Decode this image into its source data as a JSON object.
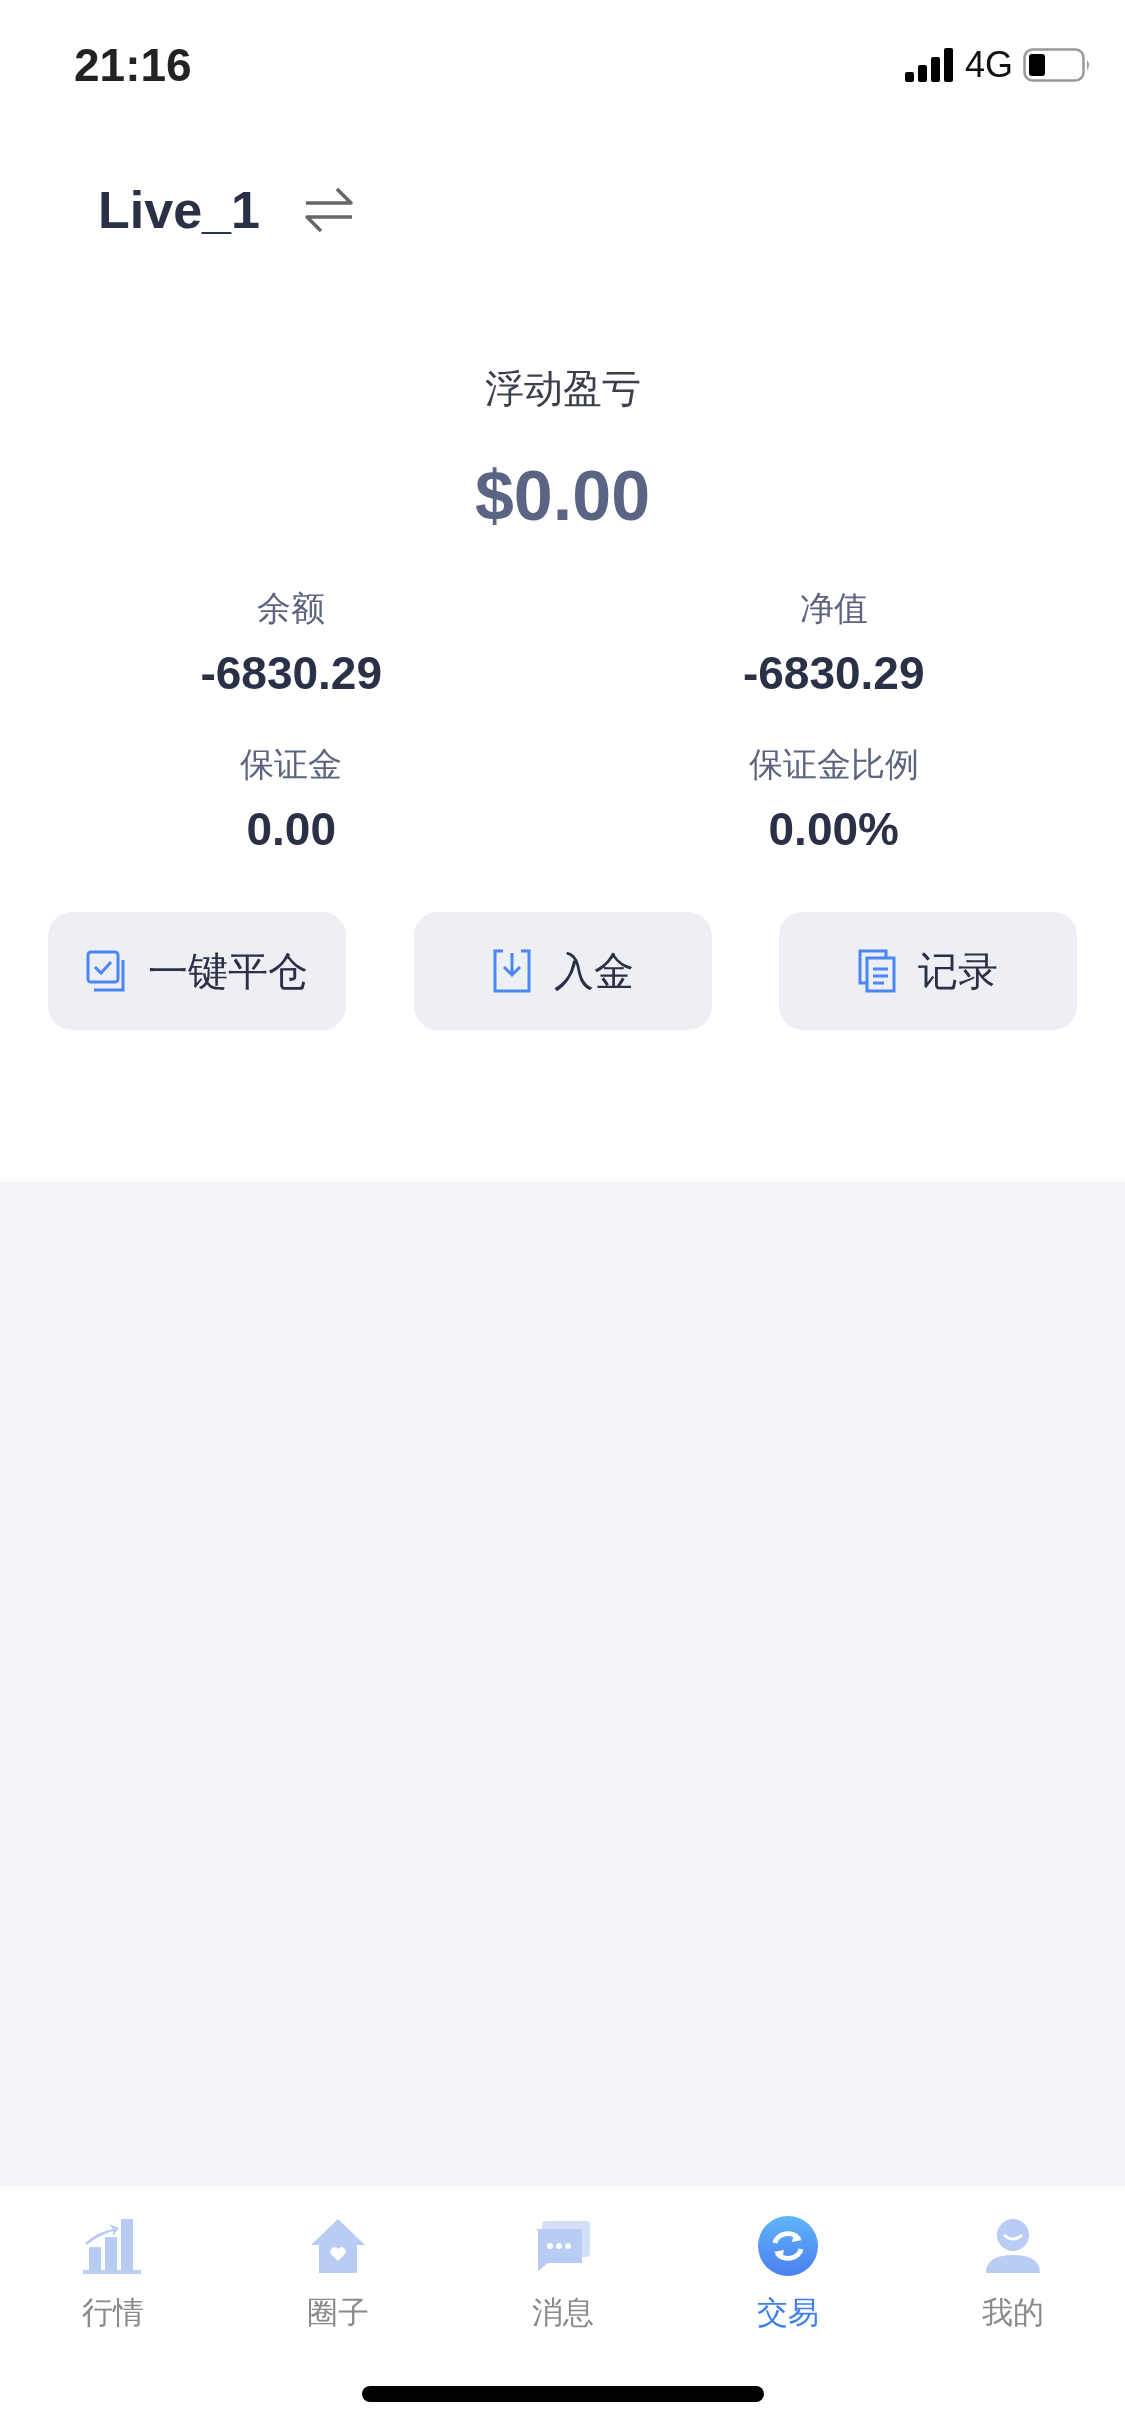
{
  "status_bar": {
    "time": "21:16",
    "network": "4G"
  },
  "account": {
    "name": "Live_1"
  },
  "floating_pnl": {
    "label": "浮动盈亏",
    "value": "$0.00"
  },
  "stats": [
    {
      "label": "余额",
      "value": "-6830.29"
    },
    {
      "label": "净值",
      "value": "-6830.29"
    },
    {
      "label": "保证金",
      "value": "0.00"
    },
    {
      "label": "保证金比例",
      "value": "0.00%"
    }
  ],
  "actions": [
    {
      "kind": "close-all",
      "label": "一键平仓"
    },
    {
      "kind": "deposit",
      "label": "入金"
    },
    {
      "kind": "records",
      "label": "记录"
    }
  ],
  "tab_bar": [
    {
      "kind": "market",
      "label": "行情",
      "selected": false
    },
    {
      "kind": "circle",
      "label": "圈子",
      "selected": false
    },
    {
      "kind": "messages",
      "label": "消息",
      "selected": false
    },
    {
      "kind": "trade",
      "label": "交易",
      "selected": true
    },
    {
      "kind": "me",
      "label": "我的",
      "selected": false
    }
  ]
}
